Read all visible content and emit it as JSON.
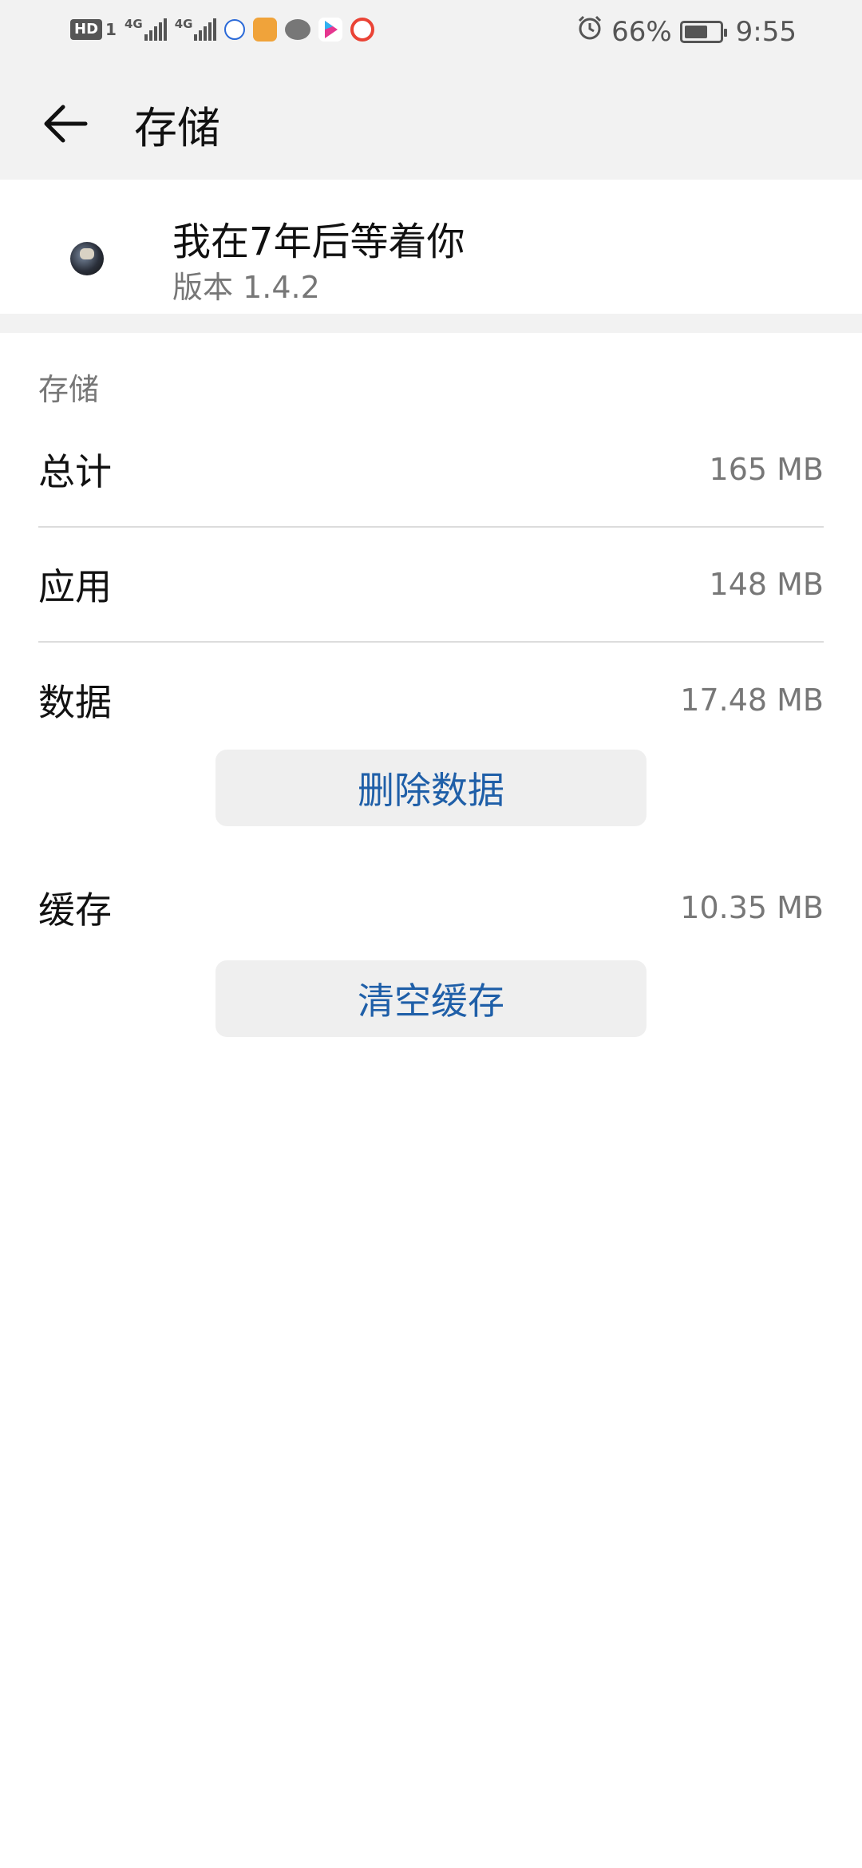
{
  "statusbar": {
    "hd_badge": "HD",
    "sim_number": "1",
    "net1": "4G",
    "net2": "4G",
    "battery_percent": "66%",
    "battery_level": 0.66,
    "time": "9:55",
    "icons": [
      "baidu-icon",
      "folder-icon",
      "wechat-icon",
      "youku-icon",
      "browser-icon",
      "alarm-icon"
    ]
  },
  "header": {
    "title": "存储"
  },
  "app": {
    "name": "我在7年后等着你",
    "version": "版本 1.4.2"
  },
  "storage": {
    "section_label": "存储",
    "total_label": "总计",
    "total_value": "165 MB",
    "app_label": "应用",
    "app_value": "148 MB",
    "data_label": "数据",
    "data_value": "17.48 MB",
    "delete_data_button": "删除数据",
    "cache_label": "缓存",
    "cache_value": "10.35 MB",
    "clear_cache_button": "清空缓存"
  },
  "colors": {
    "accent": "#1f5fa8",
    "header_bg": "#f2f2f2",
    "button_bg": "#efefef"
  }
}
